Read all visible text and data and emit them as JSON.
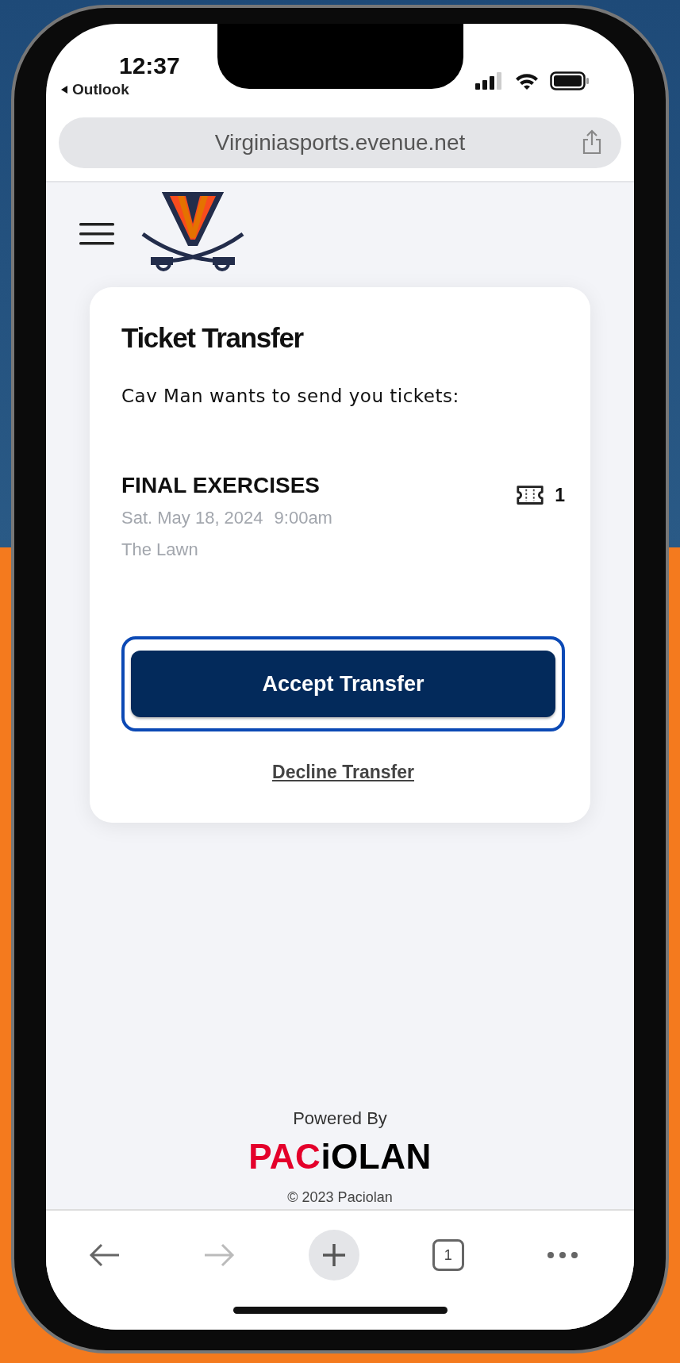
{
  "status_bar": {
    "time": "12:37",
    "back_app": "Outlook"
  },
  "address_bar": {
    "url": "Virginiasports.evenue.net"
  },
  "card": {
    "title": "Ticket Transfer",
    "message": "Cav Man wants to send you tickets:",
    "event": {
      "name": "FINAL EXERCISES",
      "date": "Sat. May 18, 2024",
      "time": "9:00am",
      "venue": "The Lawn",
      "ticket_count": "1"
    },
    "accept_button": {
      "label": "Accept Transfer",
      "focused": true
    },
    "decline_link": "Decline Transfer"
  },
  "footer": {
    "powered_by": "Powered By",
    "logo": [
      {
        "text": "PAC",
        "color": "#e4002b"
      },
      {
        "text": "iOLAN",
        "color": "#000000"
      }
    ],
    "copyright": "© 2023 Paciolan"
  },
  "toolbar": [
    {
      "kind": "back",
      "disabled": false
    },
    {
      "kind": "forward",
      "disabled": true
    },
    {
      "kind": "new_tab"
    },
    {
      "kind": "tabs",
      "label": "1"
    },
    {
      "kind": "more"
    }
  ]
}
